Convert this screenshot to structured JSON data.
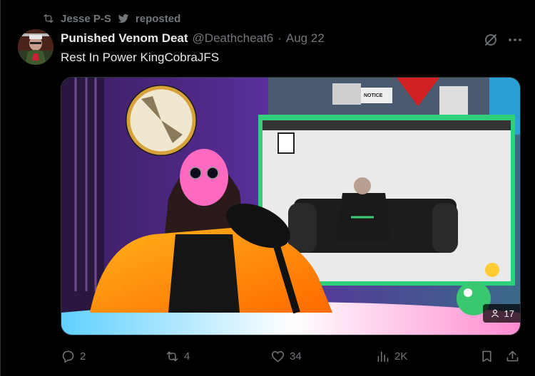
{
  "repost": {
    "label": "Jesse P-S",
    "suffix": "reposted"
  },
  "tweet": {
    "display_name": "Punished Venom Deat",
    "handle": "@Deathcheat6",
    "separator": "·",
    "date": "Aug 22",
    "text": "Rest In Power KingCobraJFS"
  },
  "media": {
    "monitor_notice": "NOTICE",
    "views_badge": "17"
  },
  "actions": {
    "replies": "2",
    "reposts": "4",
    "likes": "34",
    "views": "2K"
  },
  "icons": {
    "repost": "repost-icon",
    "bird": "bird-icon",
    "grok": "grok-icon",
    "more": "more-icon",
    "reply": "reply-icon",
    "like": "heart-icon",
    "views": "views-icon",
    "bookmark": "bookmark-icon",
    "share": "share-icon"
  },
  "colors": {
    "text": "#e7e9ea",
    "secondary": "#71767b",
    "background": "#000000",
    "border": "#2f3336"
  }
}
